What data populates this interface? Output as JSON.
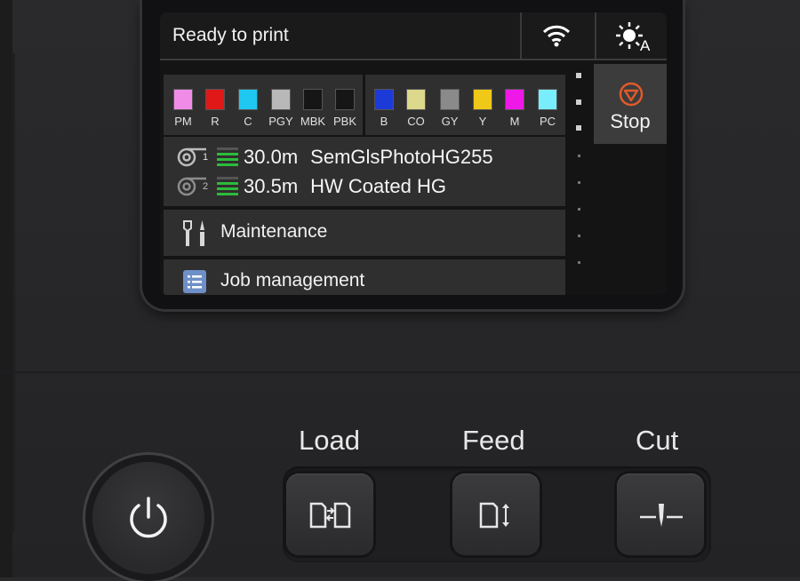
{
  "status": {
    "text": "Ready to print",
    "wifi_icon": "wifi-icon",
    "brightness_icon": "auto-brightness-icon"
  },
  "inks": [
    {
      "label": "PM",
      "color": "#f08ce8"
    },
    {
      "label": "R",
      "color": "#e01818"
    },
    {
      "label": "C",
      "color": "#1ec8f0"
    },
    {
      "label": "PGY",
      "color": "#b8b8b8"
    },
    {
      "label": "MBK",
      "color": "#161616"
    },
    {
      "label": "PBK",
      "color": "#161616"
    },
    {
      "label": "B",
      "color": "#1c3ad8"
    },
    {
      "label": "CO",
      "color": "#dcd88c"
    },
    {
      "label": "GY",
      "color": "#8a8a8a"
    },
    {
      "label": "Y",
      "color": "#f0c818"
    },
    {
      "label": "M",
      "color": "#f018e8"
    },
    {
      "label": "PC",
      "color": "#78eefc"
    }
  ],
  "paper": {
    "roll1": {
      "length": "30.0m",
      "name": "SemGlsPhotoHG255"
    },
    "roll2": {
      "length": "30.5m",
      "name": "HW Coated HG"
    }
  },
  "menu": {
    "maintenance": "Maintenance",
    "job_management": "Job management"
  },
  "stop": {
    "label": "Stop",
    "accent": "#e05a2a"
  },
  "hardware": {
    "load": "Load",
    "feed": "Feed",
    "cut": "Cut",
    "power_icon": "power-icon"
  }
}
